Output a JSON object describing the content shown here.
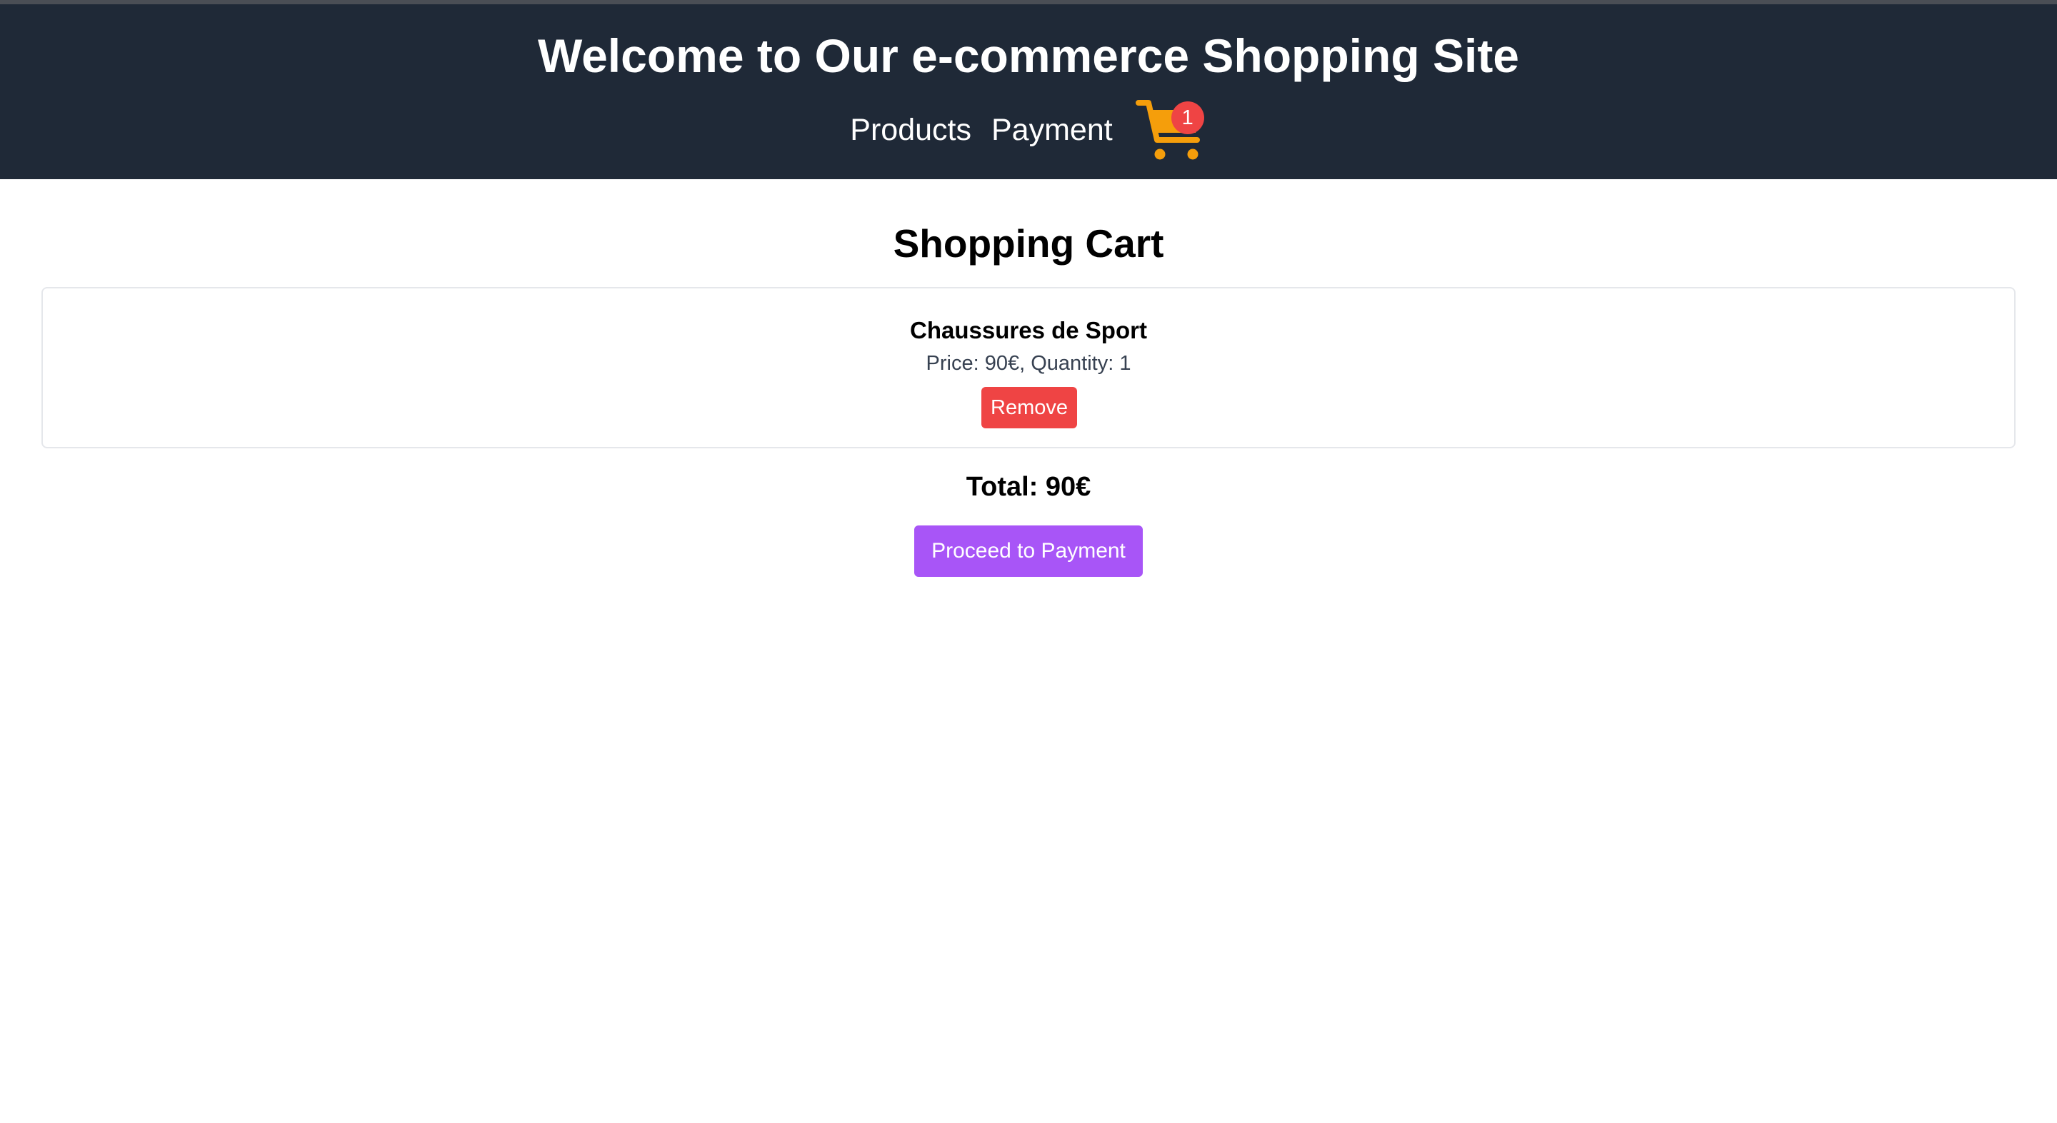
{
  "header": {
    "title": "Welcome to Our e-commerce Shopping Site",
    "nav": {
      "products_label": "Products",
      "payment_label": "Payment"
    },
    "cart": {
      "icon": "shopping-cart-icon",
      "count": "1",
      "icon_color": "#f59e0b",
      "badge_color": "#ef4444"
    },
    "background_color": "#1f2937"
  },
  "main": {
    "heading": "Shopping Cart",
    "items": [
      {
        "name": "Chaussures de Sport",
        "details": "Price: 90€, Quantity: 1",
        "remove_label": "Remove"
      }
    ],
    "total": "Total: 90€",
    "proceed_label": "Proceed to Payment",
    "remove_color": "#ef4444",
    "proceed_color": "#a855f7"
  }
}
